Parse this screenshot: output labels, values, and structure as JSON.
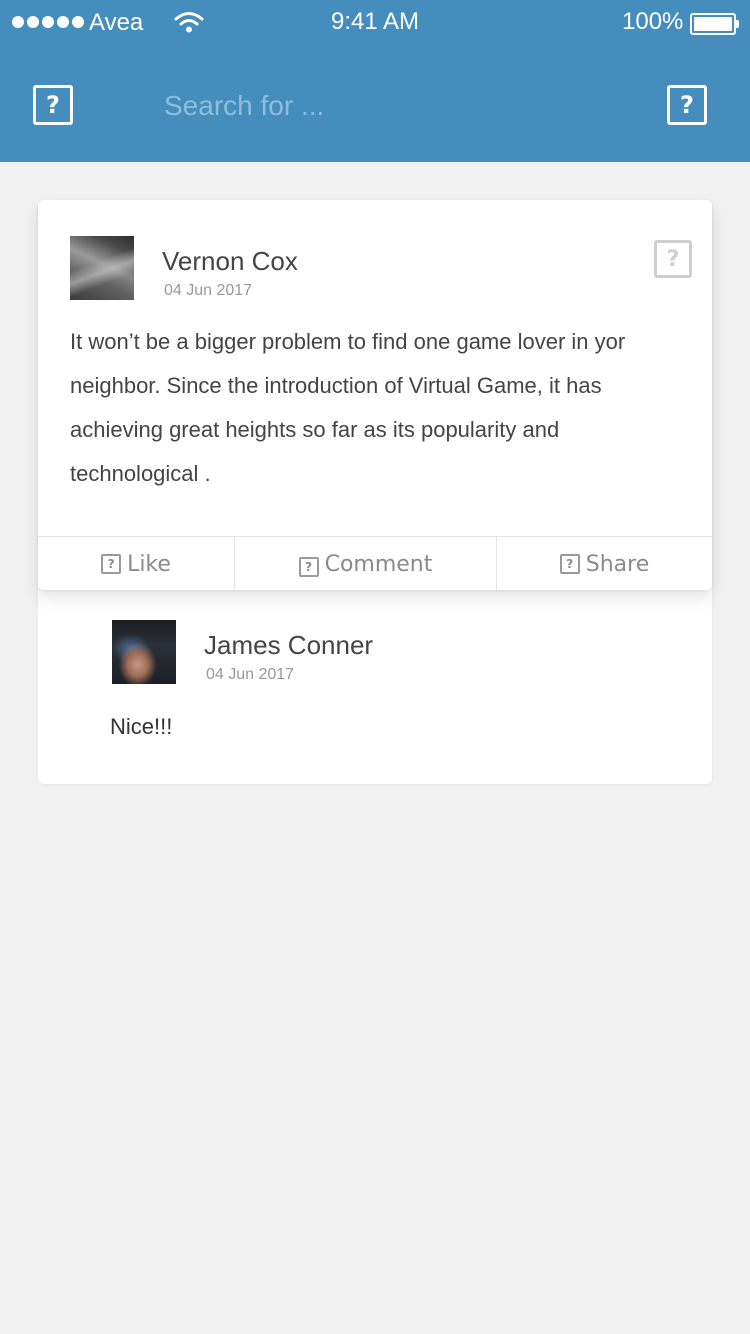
{
  "status_bar": {
    "carrier": "Avea",
    "time": "9:41 AM",
    "battery": "100%"
  },
  "header": {
    "left_icon": "question-icon",
    "right_icon": "question-icon",
    "search_placeholder": "Search for ..."
  },
  "post": {
    "author": "Vernon Cox",
    "date": "04 Jun 2017",
    "menu_icon": "question-icon",
    "body": "It won’t be a bigger problem to find one game lover in yor neighbor. Since the introduction of Virtual Game, it has achieving great heights so far as its popularity and technological .",
    "actions": {
      "like": "Like",
      "comment": "Comment",
      "share": "Share"
    }
  },
  "comment": {
    "author": "James Conner",
    "date": "04 Jun 2017",
    "text": "Nice!!!"
  },
  "colors": {
    "header_bg": "#448dbd",
    "page_bg": "#f1f1f1"
  }
}
